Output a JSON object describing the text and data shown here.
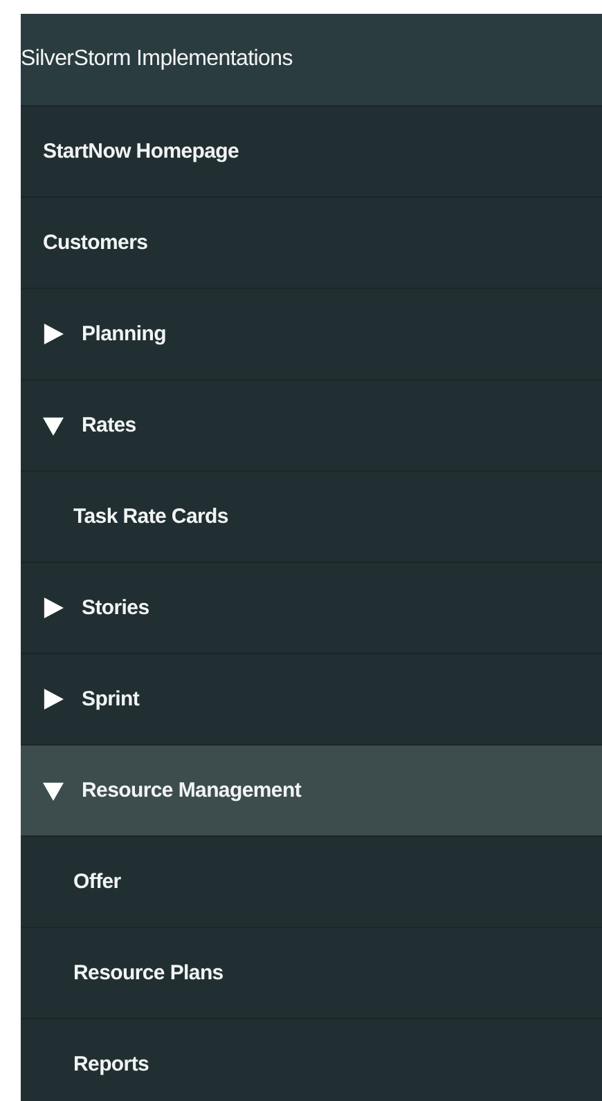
{
  "header": {
    "title": "SilverStorm Implementations"
  },
  "nav": {
    "items": [
      {
        "label": "StartNow Homepage",
        "kind": "link",
        "selected": false
      },
      {
        "label": "Customers",
        "kind": "link",
        "selected": false
      },
      {
        "label": "Planning",
        "kind": "group",
        "expanded": false,
        "selected": false
      },
      {
        "label": "Rates",
        "kind": "group",
        "expanded": true,
        "selected": false,
        "children": [
          {
            "label": "Task Rate Cards",
            "selected": false
          }
        ]
      },
      {
        "label": "Stories",
        "kind": "group",
        "expanded": false,
        "selected": false
      },
      {
        "label": "Sprint",
        "kind": "group",
        "expanded": false,
        "selected": false
      },
      {
        "label": "Resource Management",
        "kind": "group",
        "expanded": true,
        "selected": true,
        "children": [
          {
            "label": "Offer",
            "selected": false
          },
          {
            "label": "Resource Plans",
            "selected": false
          },
          {
            "label": "Reports",
            "selected": false
          }
        ]
      }
    ]
  }
}
